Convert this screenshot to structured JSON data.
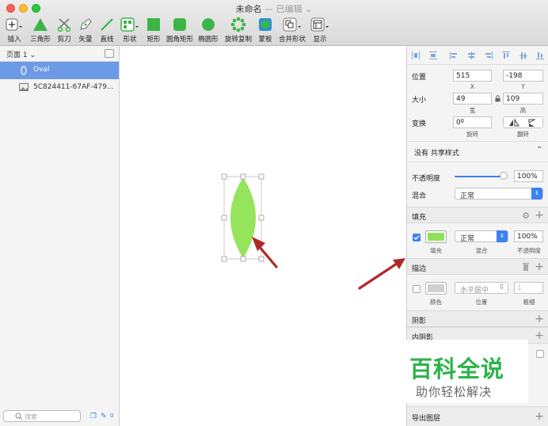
{
  "window": {
    "title": "未命名",
    "edited": "— 已编辑 ⌄"
  },
  "toolbar": {
    "items": [
      {
        "label": "插入",
        "icon": "plus-icon"
      },
      {
        "label": "三角形",
        "icon": "triangle-icon"
      },
      {
        "label": "剪刀",
        "icon": "scissors-icon"
      },
      {
        "label": "矢量",
        "icon": "pen-icon"
      },
      {
        "label": "直线",
        "icon": "line-icon"
      },
      {
        "label": "形状",
        "icon": "shapes-icon"
      },
      {
        "label": "矩形",
        "icon": "rectangle-icon"
      },
      {
        "label": "圆角矩形",
        "icon": "rounded-rect-icon"
      },
      {
        "label": "椭圆形",
        "icon": "oval-icon"
      },
      {
        "label": "旋转复制",
        "icon": "rotate-copy-icon"
      },
      {
        "label": "蒙板",
        "icon": "mask-icon"
      },
      {
        "label": "合并形状",
        "icon": "combine-icon"
      },
      {
        "label": "显示",
        "icon": "view-icon"
      }
    ],
    "accent": "#3cb547"
  },
  "layers": {
    "page_label": "页面 1 ⌄",
    "items": [
      {
        "name": "Oval",
        "selected": true
      },
      {
        "name": "5C824411-67AF-479..."
      }
    ],
    "search_placeholder": "搜索",
    "selected_color": "#6c9ae6"
  },
  "inspector": {
    "position": {
      "label": "位置",
      "x": "515",
      "y": "-198",
      "x_label": "X",
      "y_label": "Y"
    },
    "size": {
      "label": "大小",
      "w": "49",
      "h": "109",
      "w_label": "宽",
      "h_label": "高"
    },
    "transform": {
      "label": "变换",
      "rotate": "0º",
      "rotate_label": "旋转",
      "flip_label": "翻转"
    },
    "shared_style": "没有 共享样式",
    "opacity": {
      "label": "不透明度",
      "value": "100%"
    },
    "blend": {
      "label": "混合",
      "value": "正常"
    },
    "fill": {
      "title": "填充",
      "color": "#8de25a",
      "blend": "正常",
      "opacity": "100%",
      "col1": "填充",
      "col2": "混合",
      "col3": "不透明度"
    },
    "border": {
      "title": "描边",
      "position": "水平居中",
      "thickness": "1",
      "col1": "颜色",
      "col2": "位置",
      "col3": "粗细"
    },
    "shadow": "阴影",
    "inner_shadow": "内阴影",
    "export": "导出图层"
  },
  "canvas": {
    "shape_color": "#96e35c",
    "arrow_color": "#b02828"
  },
  "watermark": {
    "big": "百科全说",
    "small": "助你轻松解决"
  }
}
